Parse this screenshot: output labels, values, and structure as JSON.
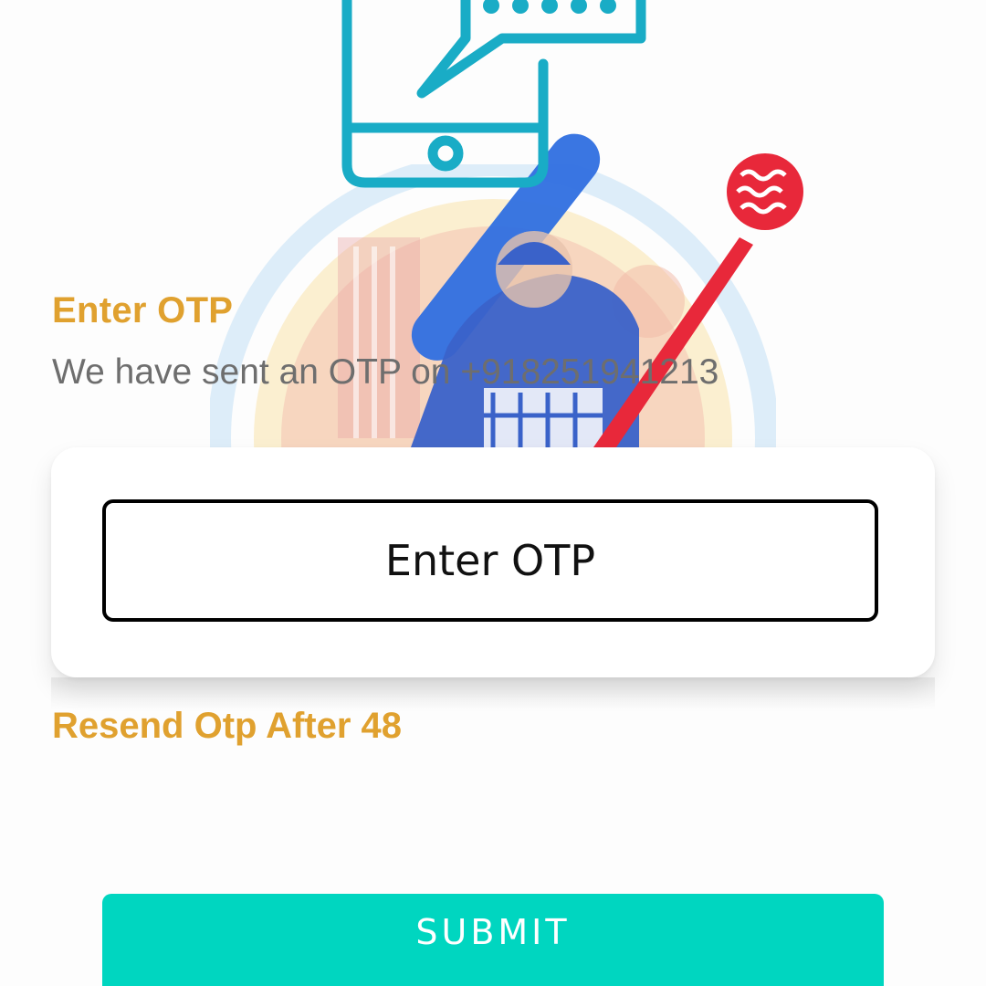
{
  "header": {
    "illustration_icon": "phone-otp-icon",
    "cricket_icon": "cricket-batsman-icon"
  },
  "otp": {
    "title": "Enter OTP",
    "sent_message": "We have sent an OTP on +918251941213",
    "input_placeholder": "Enter OTP",
    "input_value": "",
    "resend_text": "Resend Otp After 48"
  },
  "actions": {
    "submit_label": "SUBMIT"
  },
  "colors": {
    "accent_orange": "#e0a12f",
    "submit_teal": "#00d6c0",
    "illustration_teal": "#19acc6",
    "bat_blue": "#2f6fe0",
    "ball_red": "#e8283a"
  }
}
